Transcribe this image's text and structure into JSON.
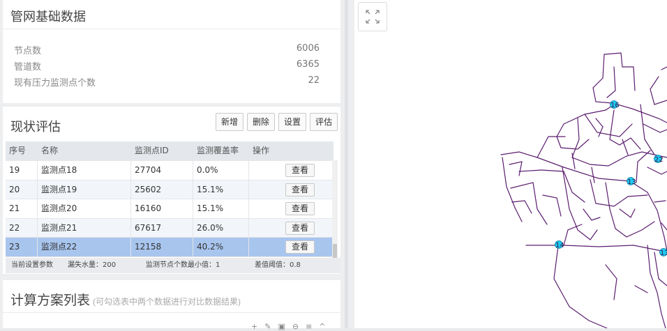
{
  "network_card": {
    "title": "管网基础数据",
    "stats": [
      {
        "label": "节点数",
        "value": "6006"
      },
      {
        "label": "管道数",
        "value": "6365"
      },
      {
        "label": "现有压力监测点个数",
        "value": "22"
      }
    ]
  },
  "assessment_card": {
    "title": "现状评估",
    "buttons": [
      "新增",
      "删除",
      "设置",
      "评估"
    ],
    "columns": [
      "序号",
      "名称",
      "监测点ID",
      "监测覆盖率",
      "操作"
    ],
    "rows": [
      {
        "no": "19",
        "name": "监测点18",
        "id": "27704",
        "coverage": "0.0%",
        "action": "查看"
      },
      {
        "no": "20",
        "name": "监测点19",
        "id": "25602",
        "coverage": "15.1%",
        "action": "查看"
      },
      {
        "no": "21",
        "name": "监测点20",
        "id": "16160",
        "coverage": "15.1%",
        "action": "查看"
      },
      {
        "no": "22",
        "name": "监测点21",
        "id": "67617",
        "coverage": "26.0%",
        "action": "查看"
      },
      {
        "no": "23",
        "name": "监测点22",
        "id": "12158",
        "coverage": "40.2%",
        "action": "查看"
      }
    ],
    "selected_row": 4,
    "status": {
      "label": "当前设置参数",
      "leak": "漏失水量：200",
      "min_nodes": "监测节点个数最小值：1",
      "threshold": "差值阈值：0.8"
    }
  },
  "plans_card": {
    "title": "计算方案列表",
    "hint": "(可勾选表中两个数据进行对比数据结果)"
  },
  "map": {
    "markers": [
      "16",
      "22",
      "13",
      "14",
      "13"
    ],
    "pipe_color": "#5b1d6e",
    "marker_color": "#1ec8f0"
  }
}
